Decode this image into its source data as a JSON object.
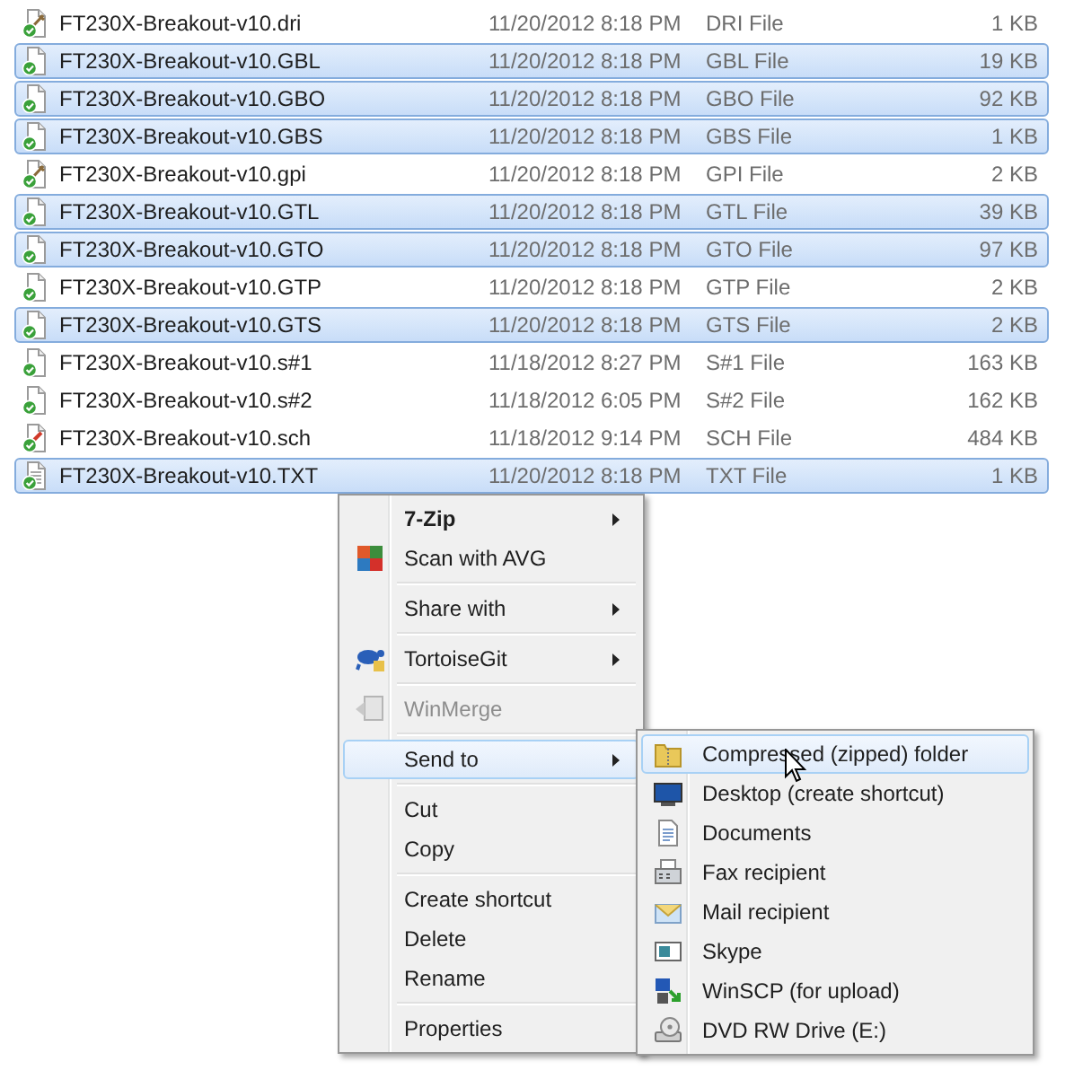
{
  "files": [
    {
      "name": "FT230X-Breakout-v10.dri",
      "date": "11/20/2012 8:18 PM",
      "type": "DRI File",
      "size": "1 KB",
      "selected": false
    },
    {
      "name": "FT230X-Breakout-v10.GBL",
      "date": "11/20/2012 8:18 PM",
      "type": "GBL File",
      "size": "19 KB",
      "selected": true
    },
    {
      "name": "FT230X-Breakout-v10.GBO",
      "date": "11/20/2012 8:18 PM",
      "type": "GBO File",
      "size": "92 KB",
      "selected": true
    },
    {
      "name": "FT230X-Breakout-v10.GBS",
      "date": "11/20/2012 8:18 PM",
      "type": "GBS File",
      "size": "1 KB",
      "selected": true
    },
    {
      "name": "FT230X-Breakout-v10.gpi",
      "date": "11/20/2012 8:18 PM",
      "type": "GPI File",
      "size": "2 KB",
      "selected": false
    },
    {
      "name": "FT230X-Breakout-v10.GTL",
      "date": "11/20/2012 8:18 PM",
      "type": "GTL File",
      "size": "39 KB",
      "selected": true
    },
    {
      "name": "FT230X-Breakout-v10.GTO",
      "date": "11/20/2012 8:18 PM",
      "type": "GTO File",
      "size": "97 KB",
      "selected": true
    },
    {
      "name": "FT230X-Breakout-v10.GTP",
      "date": "11/20/2012 8:18 PM",
      "type": "GTP File",
      "size": "2 KB",
      "selected": false
    },
    {
      "name": "FT230X-Breakout-v10.GTS",
      "date": "11/20/2012 8:18 PM",
      "type": "GTS File",
      "size": "2 KB",
      "selected": true
    },
    {
      "name": "FT230X-Breakout-v10.s#1",
      "date": "11/18/2012 8:27 PM",
      "type": "S#1 File",
      "size": "163 KB",
      "selected": false
    },
    {
      "name": "FT230X-Breakout-v10.s#2",
      "date": "11/18/2012 6:05 PM",
      "type": "S#2 File",
      "size": "162 KB",
      "selected": false
    },
    {
      "name": "FT230X-Breakout-v10.sch",
      "date": "11/18/2012 9:14 PM",
      "type": "SCH File",
      "size": "484 KB",
      "selected": false
    },
    {
      "name": "FT230X-Breakout-v10.TXT",
      "date": "11/20/2012 8:18 PM",
      "type": "TXT File",
      "size": "1 KB",
      "selected": true
    }
  ],
  "context_menu": {
    "items": [
      {
        "kind": "item",
        "label": "7-Zip",
        "default": true,
        "has_submenu": true,
        "disabled": false,
        "selected": false
      },
      {
        "kind": "item",
        "label": "Scan with AVG",
        "default": false,
        "has_submenu": false,
        "disabled": false,
        "selected": false
      },
      {
        "kind": "separator"
      },
      {
        "kind": "item",
        "label": "Share with",
        "default": false,
        "has_submenu": true,
        "disabled": false,
        "selected": false
      },
      {
        "kind": "separator"
      },
      {
        "kind": "item",
        "label": "TortoiseGit",
        "default": false,
        "has_submenu": true,
        "disabled": false,
        "selected": false
      },
      {
        "kind": "separator"
      },
      {
        "kind": "item",
        "label": "WinMerge",
        "default": false,
        "has_submenu": false,
        "disabled": true,
        "selected": false
      },
      {
        "kind": "separator"
      },
      {
        "kind": "item",
        "label": "Send to",
        "default": false,
        "has_submenu": true,
        "disabled": false,
        "selected": true
      },
      {
        "kind": "separator"
      },
      {
        "kind": "item",
        "label": "Cut",
        "default": false,
        "has_submenu": false,
        "disabled": false,
        "selected": false
      },
      {
        "kind": "item",
        "label": "Copy",
        "default": false,
        "has_submenu": false,
        "disabled": false,
        "selected": false
      },
      {
        "kind": "separator"
      },
      {
        "kind": "item",
        "label": "Create shortcut",
        "default": false,
        "has_submenu": false,
        "disabled": false,
        "selected": false
      },
      {
        "kind": "item",
        "label": "Delete",
        "default": false,
        "has_submenu": false,
        "disabled": false,
        "selected": false
      },
      {
        "kind": "item",
        "label": "Rename",
        "default": false,
        "has_submenu": false,
        "disabled": false,
        "selected": false
      },
      {
        "kind": "separator"
      },
      {
        "kind": "item",
        "label": "Properties",
        "default": false,
        "has_submenu": false,
        "disabled": false,
        "selected": false
      }
    ]
  },
  "send_to_menu": {
    "items": [
      {
        "label": "Compressed (zipped) folder",
        "selected": true
      },
      {
        "label": "Desktop (create shortcut)",
        "selected": false
      },
      {
        "label": "Documents",
        "selected": false
      },
      {
        "label": "Fax recipient",
        "selected": false
      },
      {
        "label": "Mail recipient",
        "selected": false
      },
      {
        "label": "Skype",
        "selected": false
      },
      {
        "label": "WinSCP (for upload)",
        "selected": false
      },
      {
        "label": "DVD RW Drive (E:)",
        "selected": false
      }
    ]
  }
}
